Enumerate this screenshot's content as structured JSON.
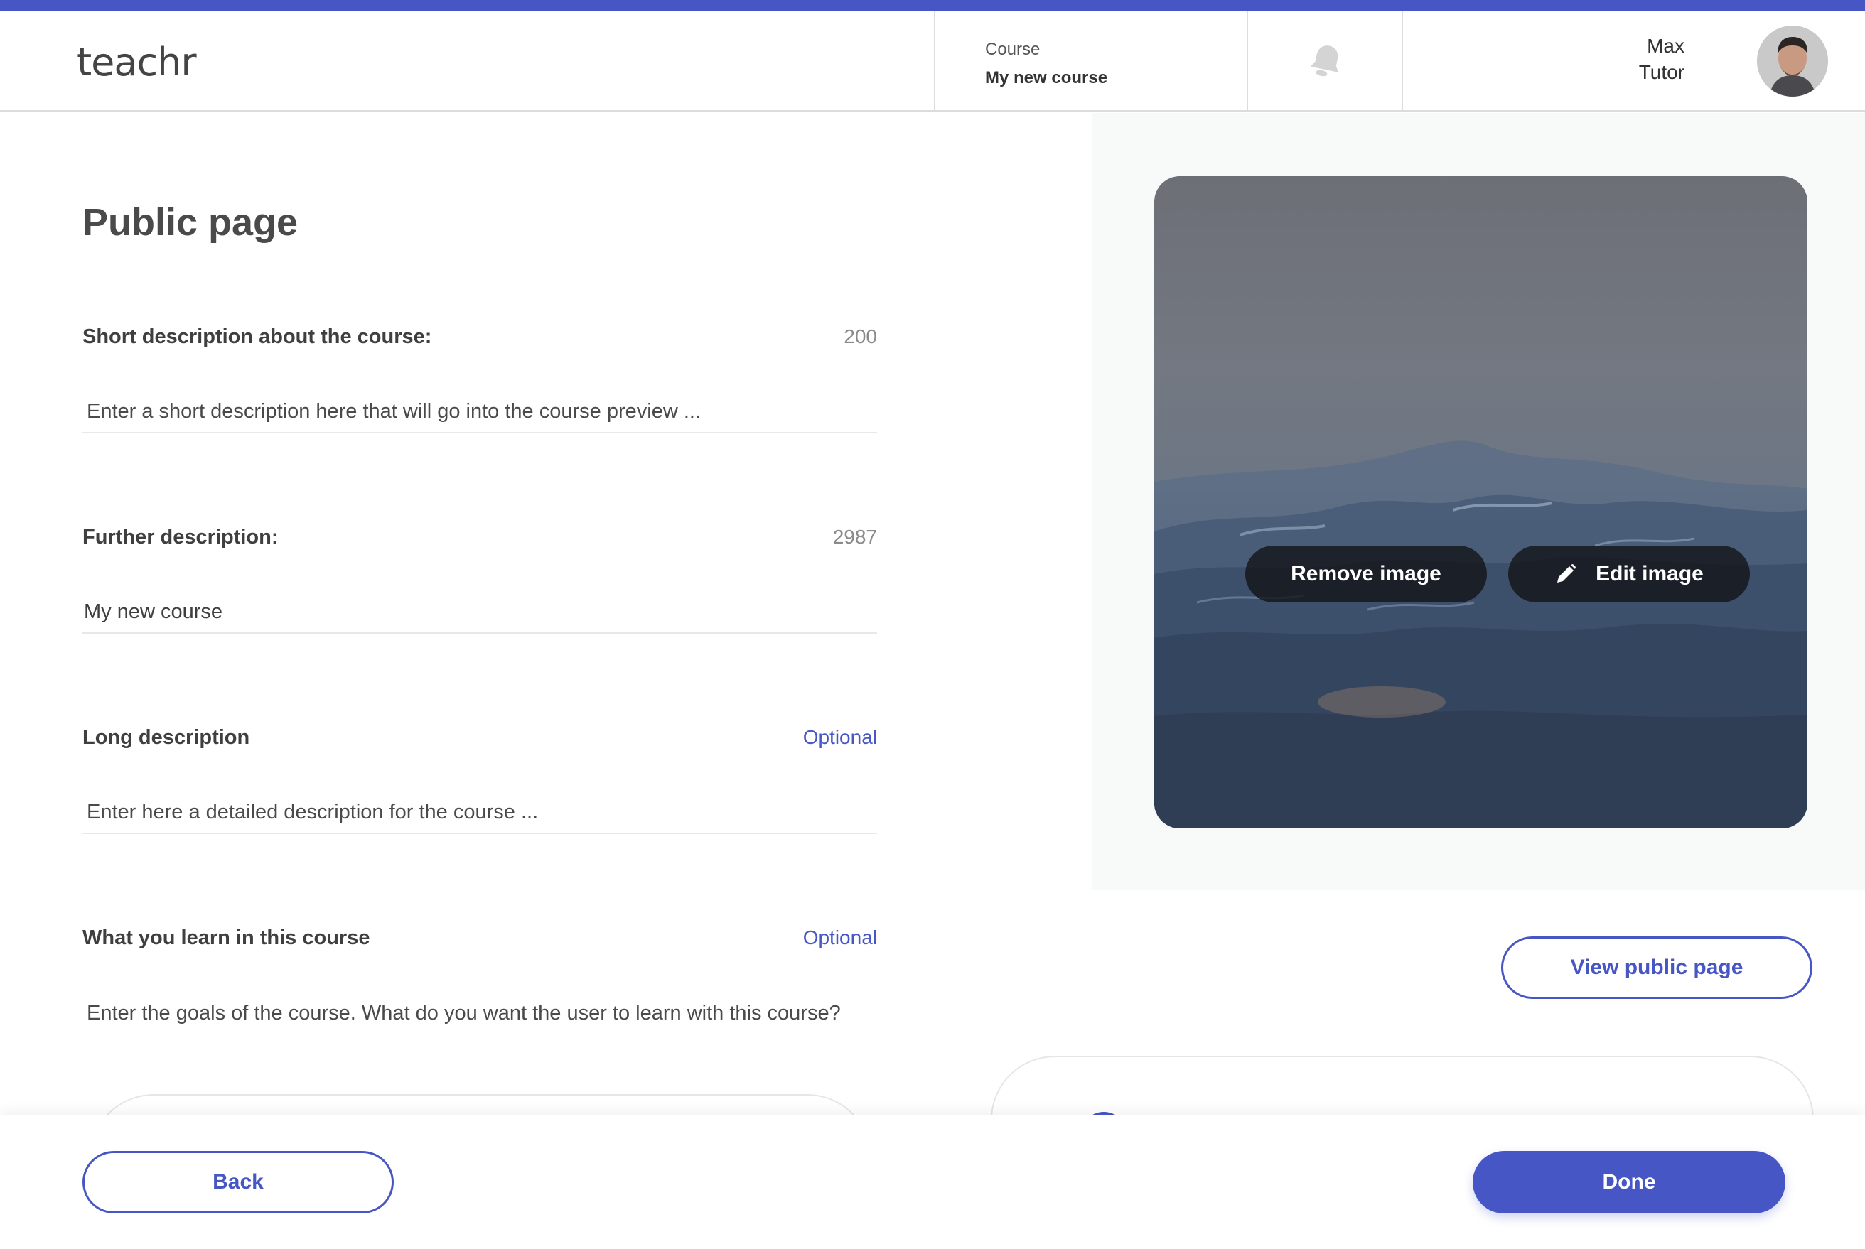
{
  "app": {
    "logo": "teachr"
  },
  "header": {
    "course_label": "Course",
    "course_value": "My new course",
    "user_first": "Max",
    "user_last": "Tutor"
  },
  "page": {
    "title": "Public page"
  },
  "fields": {
    "short_description": {
      "label": "Short description about the course:",
      "counter": "200",
      "value": "",
      "placeholder": "Enter a short description here that will go into the course preview ..."
    },
    "further_description": {
      "label": "Further description:",
      "counter": "2987",
      "value": "My new course",
      "placeholder": ""
    },
    "long_description": {
      "label": "Long description",
      "optional": "Optional",
      "value": "",
      "placeholder": "Enter here a detailed description for the course ..."
    },
    "learn_goals": {
      "label": "What you learn in this course",
      "optional": "Optional",
      "value": "",
      "placeholder": "Enter the goals of the course. What do you want the user to learn with this course?"
    }
  },
  "image_card": {
    "remove_label": "Remove image",
    "edit_label": "Edit image"
  },
  "actions": {
    "view_public_label": "View public page",
    "back_label": "Back",
    "done_label": "Done"
  },
  "colors": {
    "accent": "#4756c5",
    "text": "#3f3f3f",
    "muted": "#8a8a8a"
  }
}
